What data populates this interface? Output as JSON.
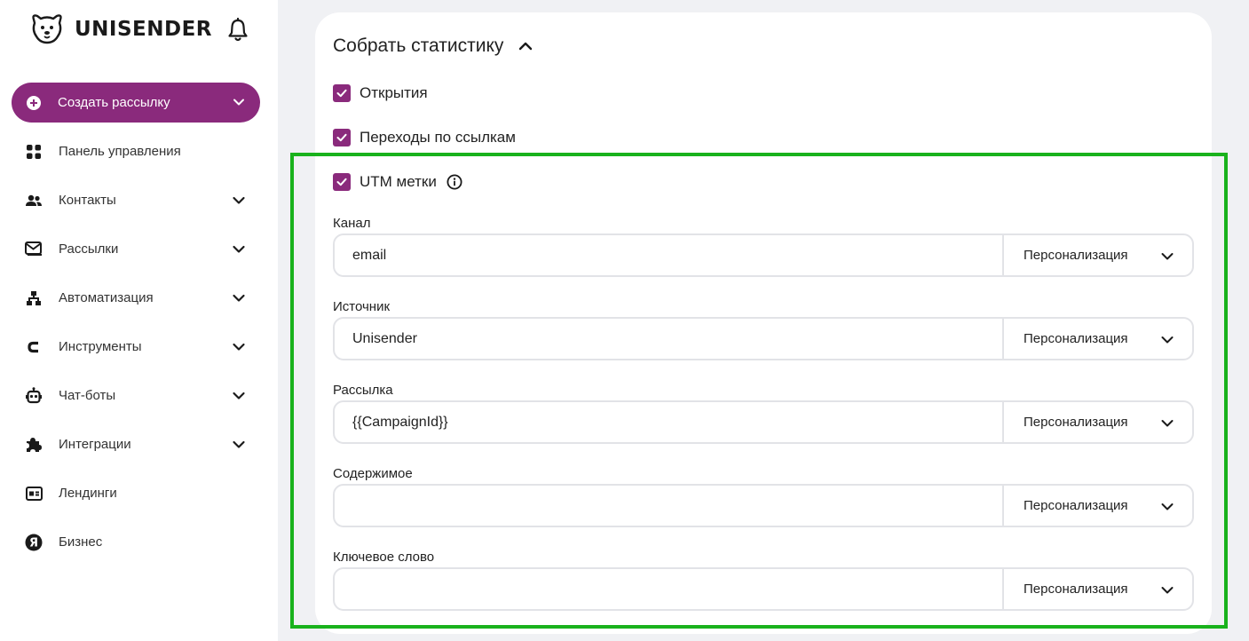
{
  "brand": {
    "name": "UNISENDER",
    "accent": "#8a2a7c",
    "highlight_color": "#19b21c"
  },
  "sidebar": {
    "create_label": "Создать рассылку",
    "items": [
      {
        "label": "Панель управления",
        "icon": "dashboard-icon",
        "has_chevron": false
      },
      {
        "label": "Контакты",
        "icon": "contacts-icon",
        "has_chevron": true
      },
      {
        "label": "Рассылки",
        "icon": "mail-icon",
        "has_chevron": true
      },
      {
        "label": "Автоматизация",
        "icon": "automation-icon",
        "has_chevron": true
      },
      {
        "label": "Инструменты",
        "icon": "tools-icon",
        "has_chevron": true
      },
      {
        "label": "Чат-боты",
        "icon": "bot-icon",
        "has_chevron": true
      },
      {
        "label": "Интеграции",
        "icon": "puzzle-icon",
        "has_chevron": true
      },
      {
        "label": "Лендинги",
        "icon": "landing-icon",
        "has_chevron": false
      },
      {
        "label": "Бизнес",
        "icon": "yandex-icon",
        "has_chevron": false
      }
    ]
  },
  "stats": {
    "title": "Собрать статистику",
    "checkboxes": [
      {
        "label": "Открытия",
        "checked": true
      },
      {
        "label": "Переходы по ссылкам",
        "checked": true
      },
      {
        "label": "UTM метки",
        "checked": true
      }
    ],
    "fields": [
      {
        "label": "Канал",
        "value": "email",
        "select": "Персонализация"
      },
      {
        "label": "Источник",
        "value": "Unisender",
        "select": "Персонализация"
      },
      {
        "label": "Рассылка",
        "value": "{{CampaignId}}",
        "select": "Персонализация"
      },
      {
        "label": "Содержимое",
        "value": "",
        "select": "Персонализация"
      },
      {
        "label": "Ключевое слово",
        "value": "",
        "select": "Персонализация"
      }
    ]
  }
}
